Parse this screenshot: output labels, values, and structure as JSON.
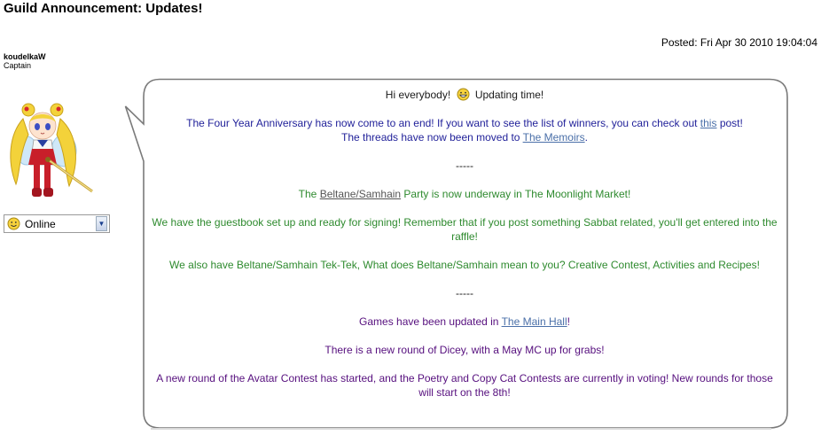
{
  "header": {
    "title": "Guild Announcement: Updates!",
    "posted": "Posted: Fri Apr 30 2010 19:04:04"
  },
  "user": {
    "name": "koudelkaW",
    "rank": "Captain",
    "status": "Online",
    "status_icon": "smiley-face-icon"
  },
  "post": {
    "greeting": "Hi everybody!",
    "greeting_tail": "Updating time!",
    "anniv_1": "The Four Year Anniversary has now come to an end! If you want to see the list of winners, you can check out ",
    "anniv_link": "this",
    "anniv_2": " post!",
    "threads_1": "The threads have now been moved to ",
    "threads_link": "The Memoirs",
    "threads_2": ".",
    "divider_1": "-----",
    "party_1": "The ",
    "party_link": "Beltane/Samhain",
    "party_2": " Party is now underway in The Moonlight Market!",
    "guestbook": "We have the guestbook set up and ready for signing! Remember that if you post something Sabbat related, you'll get entered into the raffle!",
    "tektek": "We also have Beltane/Samhain Tek-Tek, What does Beltane/Samhain mean to you? Creative Contest, Activities and Recipes!",
    "divider_2": "-----",
    "games_1": "Games have been updated in ",
    "games_link": "The Main Hall",
    "games_2": "!",
    "dicey": "There is a new round of Dicey, with a May MC up for grabs!",
    "avatar_contest": "A new round of the Avatar Contest has started, and the Poetry and Copy Cat Contests are currently in voting! New rounds for those will start on the 8th!"
  },
  "colors": {
    "blue_text": "#22229a",
    "green_text": "#2e8a2e",
    "purple_text": "#560f7e",
    "link": "#4a6fa8"
  }
}
